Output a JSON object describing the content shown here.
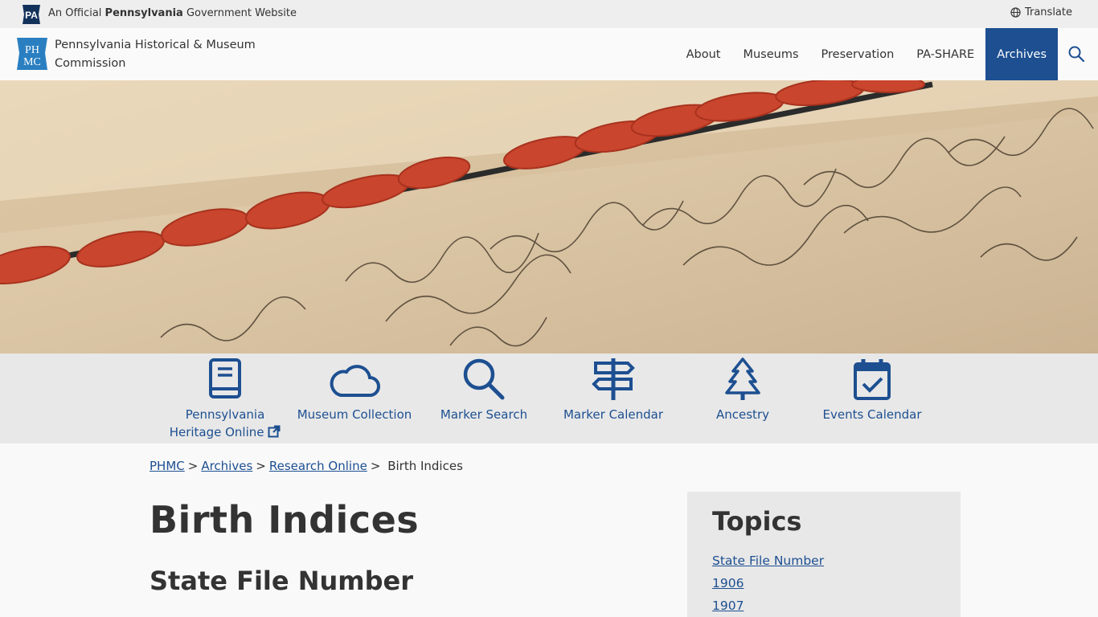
{
  "govbar": {
    "badge": "PA",
    "official_prefix": "An Official ",
    "official_state": "Pennsylvania",
    "official_suffix": " Government Website",
    "translate": "Translate"
  },
  "header": {
    "logo_text": "PHMC",
    "org_name": "Pennsylvania Historical & Museum Commission"
  },
  "nav": {
    "items": [
      {
        "label": "About"
      },
      {
        "label": "Museums"
      },
      {
        "label": "Preservation"
      },
      {
        "label": "PA-SHARE"
      },
      {
        "label": "Archives"
      }
    ],
    "active": "Archives"
  },
  "iconbar": {
    "links": [
      {
        "label": "Pennsylvania Heritage Online",
        "icon": "book-icon"
      },
      {
        "label": "Museum Collection",
        "icon": "cloud-icon"
      },
      {
        "label": "Marker Search",
        "icon": "search-icon"
      },
      {
        "label": "Marker Calendar",
        "icon": "signpost-icon"
      },
      {
        "label": "Ancestry",
        "icon": "tree-icon"
      },
      {
        "label": "Events Calendar",
        "icon": "calendar-check-icon"
      }
    ]
  },
  "breadcrumb": {
    "items": [
      "PHMC",
      "Archives",
      "Research Online"
    ],
    "current": "Birth Indices",
    "separator": ">"
  },
  "page": {
    "title": "Birth Indices",
    "section": "State File Number"
  },
  "topics": {
    "title": "Topics",
    "links": [
      "State File Number",
      "1906",
      "1907"
    ]
  },
  "colors": {
    "primary": "#1d4f91",
    "text": "#333333",
    "bar_bg": "#e8e8e8",
    "wax_seal": "#c9452d"
  }
}
